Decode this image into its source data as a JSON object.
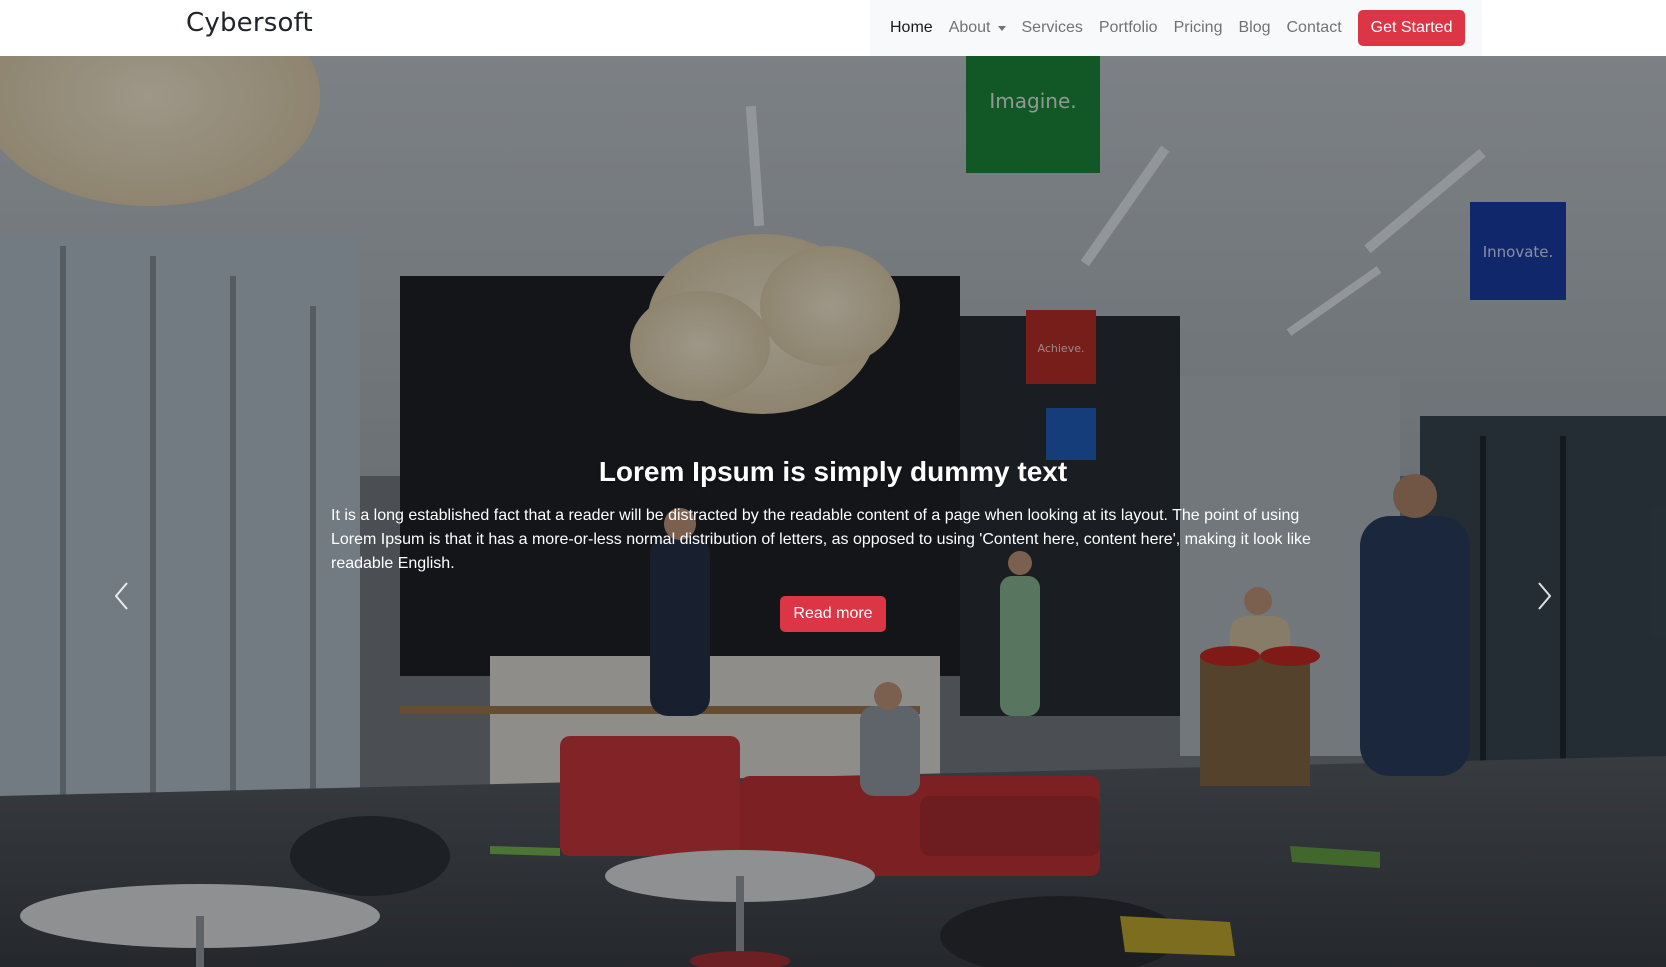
{
  "navbar": {
    "brand": "Cybersoft",
    "links": [
      {
        "label": "Home",
        "active": true
      },
      {
        "label": "About",
        "dropdown": true
      },
      {
        "label": "Services"
      },
      {
        "label": "Portfolio"
      },
      {
        "label": "Pricing"
      },
      {
        "label": "Blog"
      },
      {
        "label": "Contact"
      }
    ],
    "cta_label": "Get Started"
  },
  "hero": {
    "title": "Lorem Ipsum is simply dummy text",
    "text": "It is a long established fact that a reader will be distracted by the readable content of a page when looking at its layout. The point of using Lorem Ipsum is that it has a more-or-less normal distribution of letters, as opposed to using 'Content here, content here', making it look like readable English.",
    "button_label": "Read more",
    "banners": [
      "Imagine.",
      "Innovate.",
      "Achieve."
    ]
  },
  "colors": {
    "accent": "#dc3545",
    "nav_bg": "#f8f9fa"
  },
  "icons": {
    "prev": "chevron-left-icon",
    "next": "chevron-right-icon"
  }
}
